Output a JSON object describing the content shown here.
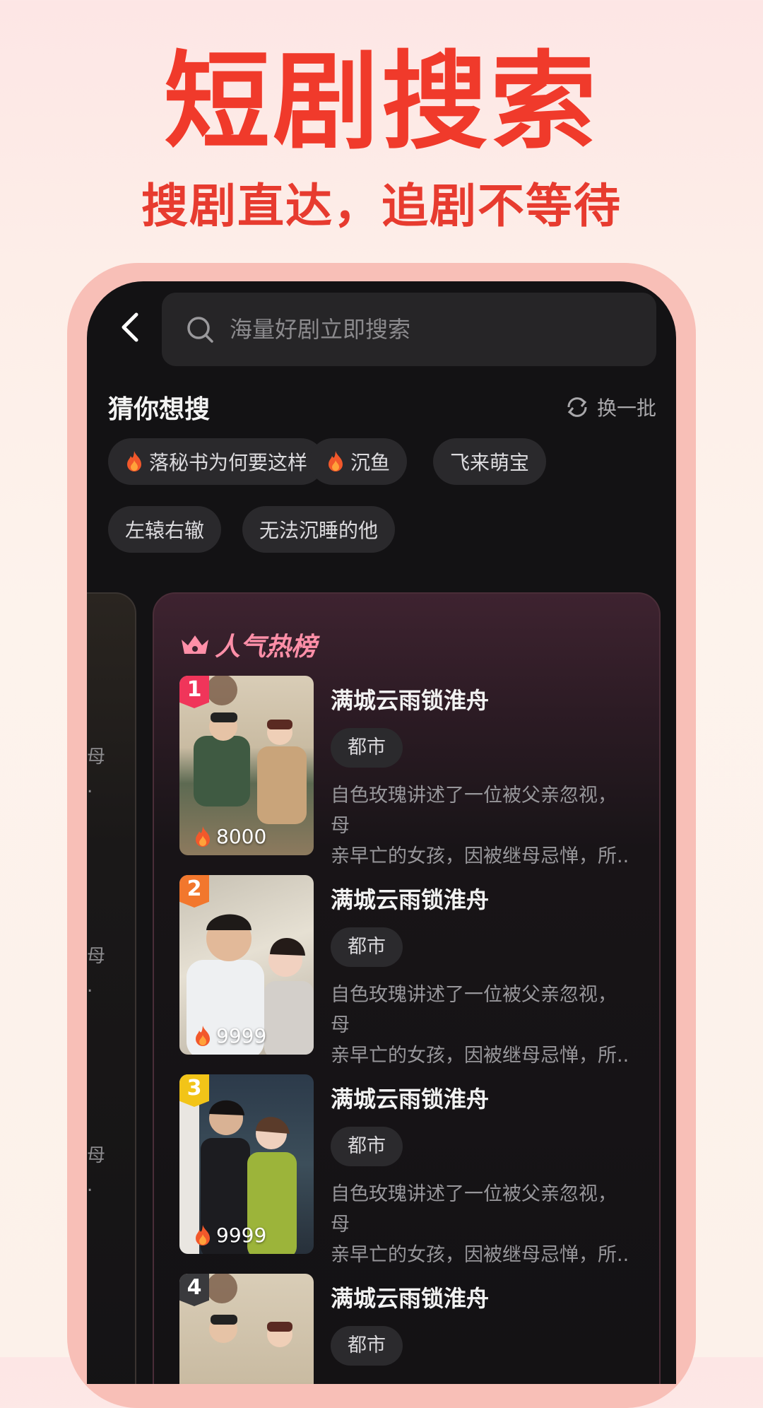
{
  "header": {
    "headline": "短剧搜索",
    "subline": "搜剧直达，追剧不等待"
  },
  "search": {
    "placeholder": "海量好剧立即搜索"
  },
  "guess": {
    "title": "猜你想搜",
    "refresh_label": "换一批",
    "chips": [
      {
        "label": "落秘书为何要这样",
        "hot": true
      },
      {
        "label": "沉鱼",
        "hot": true
      },
      {
        "label": "飞来萌宝",
        "hot": false
      },
      {
        "label": "左辕右辙",
        "hot": false
      },
      {
        "label": "无法沉睡的他",
        "hot": false
      }
    ]
  },
  "side_card": {
    "snippets": [
      {
        "l1": "母",
        "l2": "."
      },
      {
        "l1": "母",
        "l2": "."
      },
      {
        "l1": "母",
        "l2": "."
      }
    ]
  },
  "ranking": {
    "title": "人气热榜",
    "items": [
      {
        "rank": "1",
        "title": "满城云雨锁淮舟",
        "tag": "都市",
        "heat": "8000",
        "desc_l1": "自色玫瑰讲述了一位被父亲忽视，母",
        "desc_l2": "亲早亡的女孩，因被继母忌惮，所..",
        "badge_color": "#f0355a"
      },
      {
        "rank": "2",
        "title": "满城云雨锁淮舟",
        "tag": "都市",
        "heat": "9999",
        "desc_l1": "自色玫瑰讲述了一位被父亲忽视，母",
        "desc_l2": "亲早亡的女孩，因被继母忌惮，所..",
        "badge_color": "#f2772d"
      },
      {
        "rank": "3",
        "title": "满城云雨锁淮舟",
        "tag": "都市",
        "heat": "9999",
        "desc_l1": "自色玫瑰讲述了一位被父亲忽视，母",
        "desc_l2": "亲早亡的女孩，因被继母忌惮，所..",
        "badge_color": "#f2c418"
      },
      {
        "rank": "4",
        "title": "满城云雨锁淮舟",
        "tag": "都市",
        "heat": "",
        "desc_l1": "",
        "desc_l2": "",
        "badge_color": "#3a3a3d"
      }
    ]
  },
  "colors": {
    "accent": "#f03a2b",
    "screen_bg": "#131214",
    "frame": "#f8bfb7"
  }
}
